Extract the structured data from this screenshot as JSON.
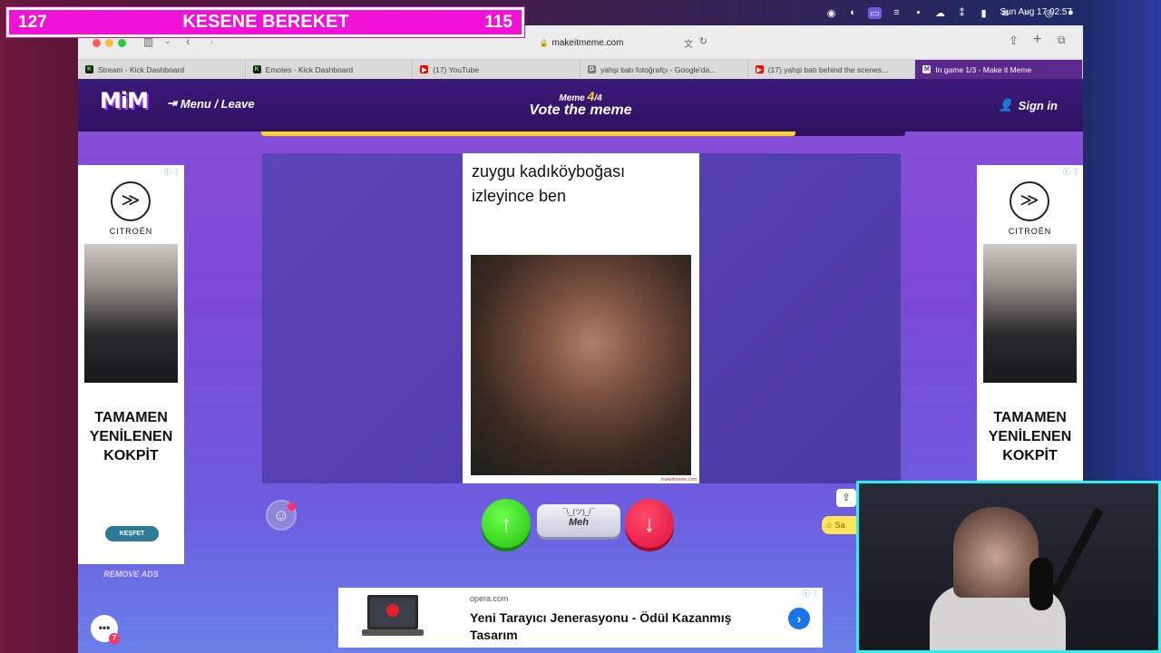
{
  "overlay": {
    "left_score": "127",
    "title": "KESENE BEREKET",
    "right_score": "115"
  },
  "menubar": {
    "clock": "Sun Aug 17  02:57"
  },
  "browser": {
    "url": "makeitmeme.com"
  },
  "tabs": [
    {
      "label": "Stream - Kick Dashboard",
      "icon": "kick-icon",
      "color": "#53fc18",
      "glyph": "K"
    },
    {
      "label": "Emotes - Kick Dashboard",
      "icon": "kick-icon",
      "color": "#53fc18",
      "glyph": "K"
    },
    {
      "label": "(17) YouTube",
      "icon": "youtube-icon",
      "color": "#ff0000",
      "glyph": "▶"
    },
    {
      "label": "yahşi batı fotoğrafçı - Google'da...",
      "icon": "google-icon",
      "color": "#777777",
      "glyph": "G"
    },
    {
      "label": "(17) yahşi batı behind the scenes...",
      "icon": "youtube-icon",
      "color": "#ff0000",
      "glyph": "▶"
    },
    {
      "label": "In game 1/3 - Make it Meme",
      "icon": "mim-icon",
      "color": "#ffffff",
      "glyph": "M"
    }
  ],
  "header": {
    "logo": "MiM",
    "menu_leave": "Menu / Leave",
    "round_label": "Meme",
    "round_current": "4",
    "round_total": "/4",
    "phase": "Vote the meme",
    "sign_in": "Sign in"
  },
  "progress": {
    "fraction": 0.83
  },
  "meme": {
    "caption_line1": "zuygu kadıköyboğası",
    "caption_line2": "izleyince ben",
    "watermark": "makeitmeme.com"
  },
  "side_ads": {
    "brand": "CITROËN",
    "headline_1": "TAMAMEN",
    "headline_2": "YENİLENEN",
    "headline_3": "KOKPİT",
    "cta": "KEŞFET",
    "remove_ads": "REMOVE ADS"
  },
  "vote": {
    "meh_face": "¯\\_(ツ)_/¯",
    "meh_label": "Meh"
  },
  "side_buttons": {
    "star_label": "Sa"
  },
  "bottom_ad": {
    "domain": "opera.com",
    "headline": "Yeni Tarayıcı Jenerasyonu - Ödül Kazanmış Tasarım"
  },
  "chat": {
    "badge": "7"
  },
  "colors": {
    "accent_pink": "#f012d6",
    "vote_up": "#21c00e",
    "vote_down": "#e0103e",
    "progress": "#ffd02a",
    "header_bg": "#3d1a79"
  }
}
